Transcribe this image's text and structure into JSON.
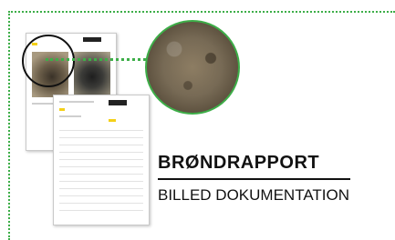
{
  "heading": {
    "title": "BRØNDRAPPORT",
    "subtitle": "BILLED DOKUMENTATION"
  },
  "colors": {
    "accent": "#3dae48",
    "text": "#111111",
    "chip": "#f4d018"
  },
  "icons": {
    "magnifier": "magnifier-circle"
  }
}
